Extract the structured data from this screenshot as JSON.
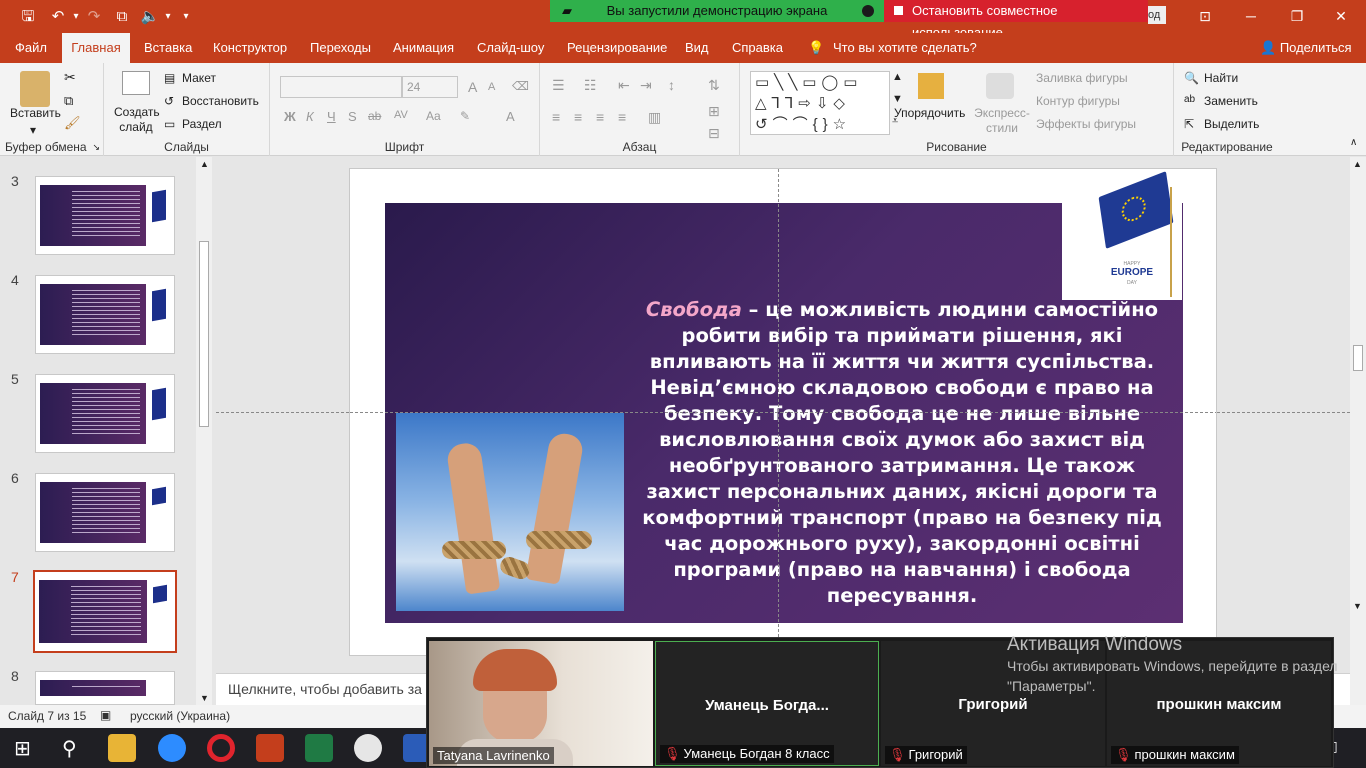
{
  "qat": {
    "save": "🖫",
    "undo": "↶",
    "redo": "↷",
    "present": "⧉",
    "volume": "🔈",
    "more": "▾"
  },
  "screen_share": {
    "status": "Вы запустили демонстрацию экрана",
    "stop_label": "Остановить совместное использование",
    "partial_right_text": "од"
  },
  "ribbon_tabs": [
    "Файл",
    "Главная",
    "Вставка",
    "Конструктор",
    "Переходы",
    "Анимация",
    "Слайд-шоу",
    "Рецензирование",
    "Вид",
    "Справка"
  ],
  "active_tab": "Главная",
  "tell_me": "Что вы хотите сделать?",
  "share": "Поделиться",
  "ribbon": {
    "clipboard": {
      "paste": "Вставить",
      "group": "Буфер обмена"
    },
    "slides": {
      "new_slide": "Создать слайд",
      "layout": "Макет",
      "reset": "Восстановить",
      "section": "Раздел",
      "group": "Слайды"
    },
    "font": {
      "font_size": "24",
      "group": "Шрифт",
      "bold": "Ж",
      "italic": "К",
      "underline": "Ч",
      "strike": "S",
      "shadow": "ab",
      "spacing": "AV",
      "case": "Aa",
      "grow": "A",
      "shrink": "A"
    },
    "paragraph": {
      "group": "Абзац"
    },
    "drawing": {
      "arrange": "Упорядочить",
      "quick_styles": "Экспресс-стили",
      "fill": "Заливка фигуры",
      "outline": "Контур фигуры",
      "effects": "Эффекты фигуры",
      "group": "Рисование"
    },
    "editing": {
      "find": "Найти",
      "replace": "Заменить",
      "select": "Выделить",
      "group": "Редактирование"
    }
  },
  "thumbnails": [
    {
      "number": "3",
      "selected": false
    },
    {
      "number": "4",
      "selected": false
    },
    {
      "number": "5",
      "selected": false
    },
    {
      "number": "6",
      "selected": false
    },
    {
      "number": "7",
      "selected": true
    },
    {
      "number": "8",
      "selected": false
    }
  ],
  "slide": {
    "highlight_word": "Свобода",
    "body": " – це можливість людини самостійно робити вибір та приймати рішення, які впливають на її життя чи життя суспільства. Невід’ємною складовою свободи є право на безпеку. Тому свобода це не лише вільне висловлювання своїх думок або захист від необґрунтованого затримання. Це також захист персональних даних, якісні дороги та комфортний транспорт (право на безпеку під час дорожнього руху), закордонні освітні програми (право на навчання) і свобода пересування.",
    "logo_line1": "HAPPY",
    "logo_line2": "EUROPE",
    "logo_line3": "DAY"
  },
  "notes_placeholder": "Щелкните, чтобы добавить за",
  "status": {
    "slide_counter": "Слайд 7 из 15",
    "language": "русский (Украина)"
  },
  "zoom_participants": [
    {
      "display": "",
      "footer": "Tatyana Lavrinenko",
      "muted": false,
      "video": true
    },
    {
      "display": "Уманець  Богда...",
      "footer": "Уманець Богдан 8 класс",
      "muted": true,
      "video": false
    },
    {
      "display": "Григорий",
      "footer": "Григорий",
      "muted": true,
      "video": false
    },
    {
      "display": "прошкин максим",
      "footer": "прошкин максим",
      "muted": true,
      "video": false
    }
  ],
  "activation": {
    "title": "Активация Windows",
    "message": "Чтобы активировать Windows, перейдите в раздел \"Параметры\"."
  },
  "colors": {
    "accent": "#c43e1c",
    "share_green": "#2fb04b",
    "stop_red": "#d7212d",
    "slide_purple": "#4a2a6a",
    "highlight_pink": "#f4a7c9"
  }
}
